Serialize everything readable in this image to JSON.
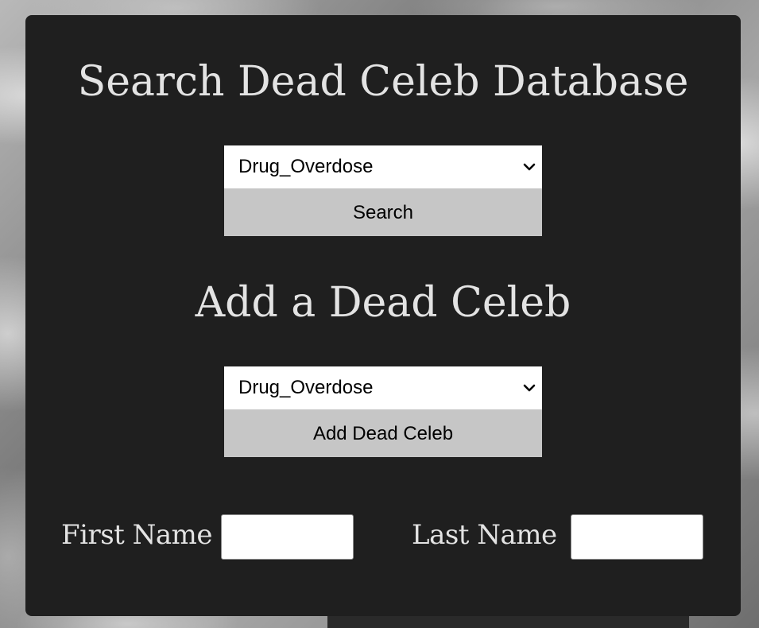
{
  "search": {
    "heading": "Search Dead Celeb Database",
    "select_value": "Drug_Overdose",
    "button_label": "Search"
  },
  "add": {
    "heading": "Add a Dead Celeb",
    "select_value": "Drug_Overdose",
    "button_label": "Add Dead Celeb"
  },
  "form": {
    "first_name_label": "First Name",
    "first_name_value": "",
    "last_name_label": "Last Name",
    "last_name_value": ""
  },
  "icons": {
    "select_chevron": "chevron-down-icon"
  },
  "colors": {
    "panel_bg": "#1f1f1f",
    "heading_text": "#e3e3e3",
    "button_bg": "#c6c6c6",
    "select_bg": "#ffffff"
  }
}
